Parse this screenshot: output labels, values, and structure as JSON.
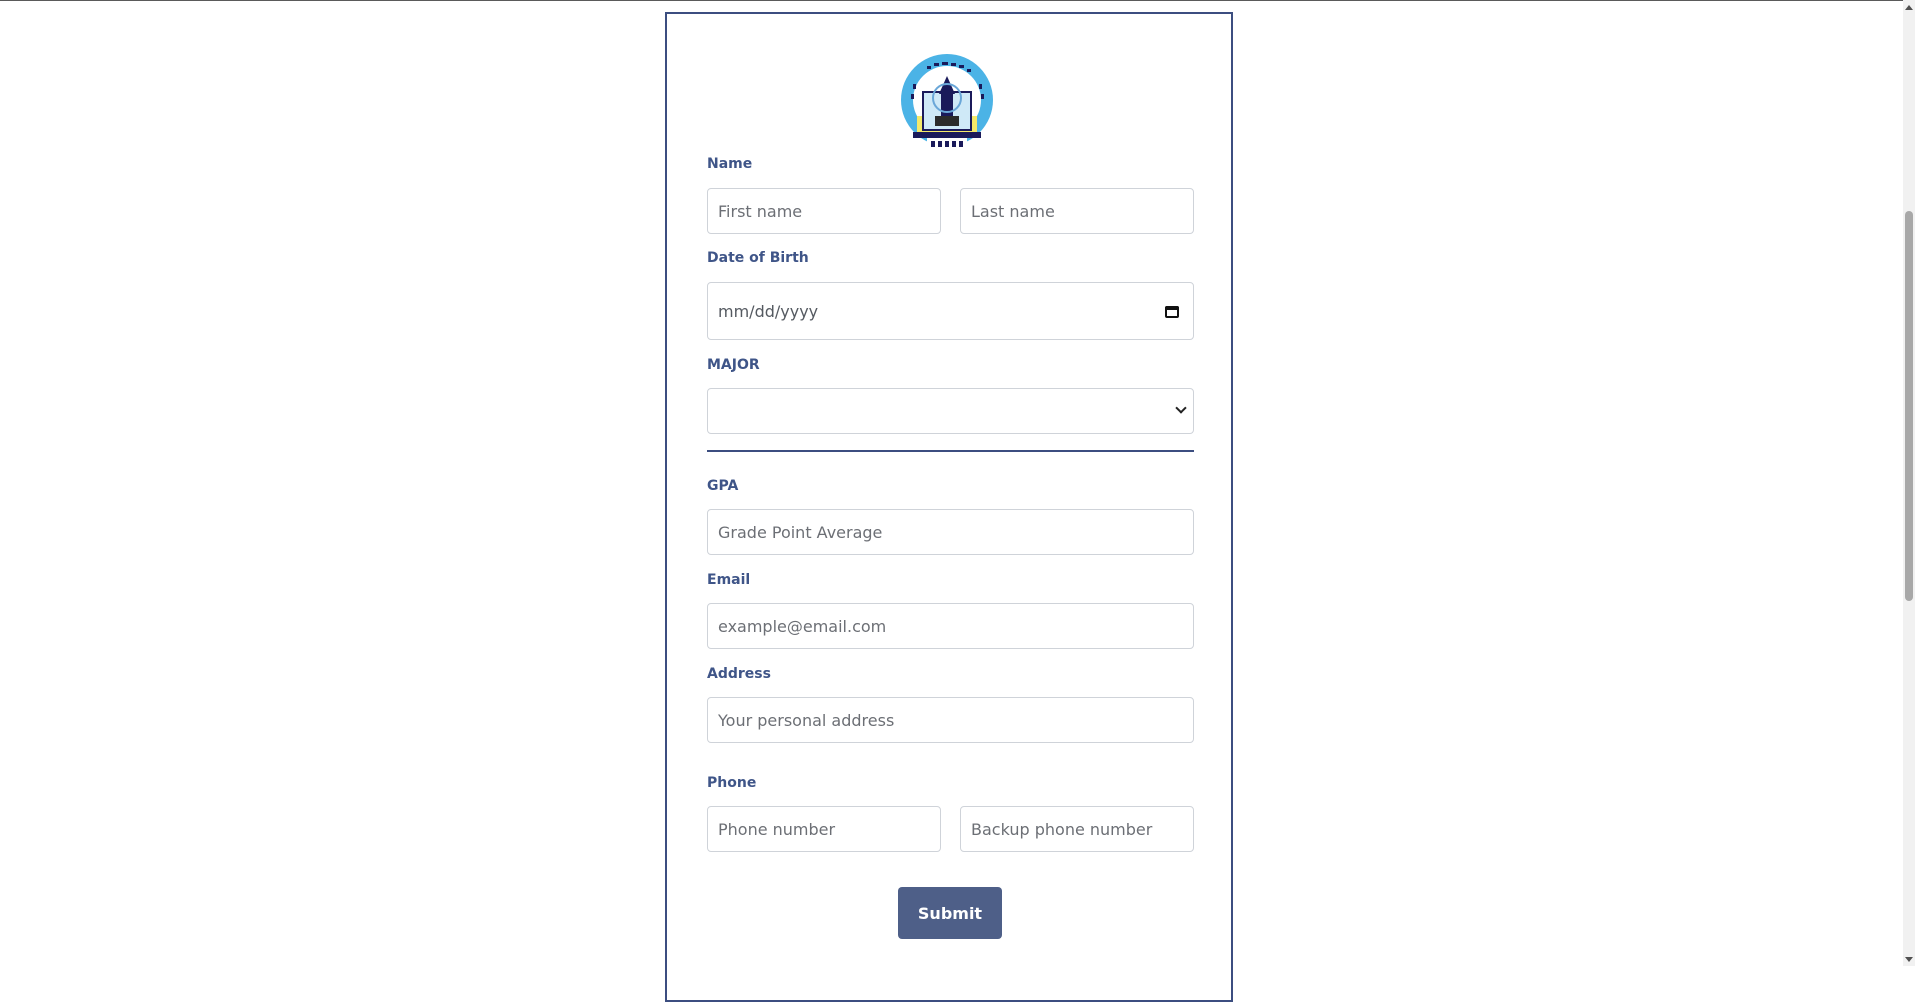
{
  "form": {
    "logo_alt_text": "M.T.I.S",
    "name_label": "Name",
    "first_name_placeholder": "First name",
    "last_name_placeholder": "Last name",
    "dob_label": "Date of Birth",
    "dob_placeholder": "mm/dd/yyyy",
    "major_label": "MAJOR",
    "major_selected": "",
    "gpa_label": "GPA",
    "gpa_placeholder": "Grade Point Average",
    "email_label": "Email",
    "email_placeholder": "example@email.com",
    "address_label": "Address",
    "address_placeholder": "Your personal address",
    "phone_label": "Phone",
    "phone_placeholder": "Phone number",
    "backup_phone_placeholder": "Backup phone number",
    "submit_label": "Submit"
  },
  "colors": {
    "accent": "#3c4e80",
    "label": "#3f5588",
    "button": "#4e5f88"
  },
  "icons": [
    "calendar-icon",
    "chevron-down-icon",
    "scroll-up-arrow-icon",
    "scroll-down-arrow-icon"
  ]
}
